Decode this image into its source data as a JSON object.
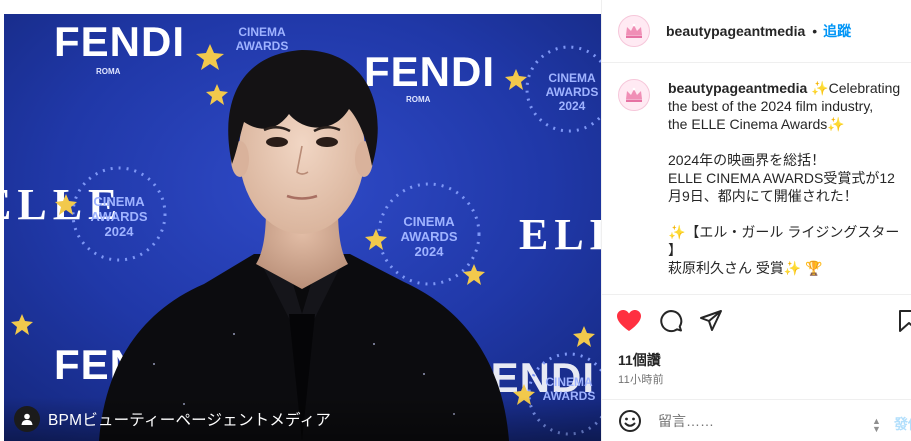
{
  "photo": {
    "backdrop_brand_logos": [
      "FENDI",
      "FENDI",
      "FENDI",
      "FENDI"
    ],
    "backdrop_event_text": [
      "CINEMA",
      "AWARDS",
      "2024"
    ],
    "backdrop_elle_mark": "ELLE",
    "backdrop_sponsor_sub": "ROMA",
    "credit_text": "BPMビューティーページェントメディア",
    "credit_icon": "user-tag-icon"
  },
  "post": {
    "username": "beautypageantmedia",
    "follow_separator": "•",
    "follow_label": "追蹤",
    "caption_username": "beautypageantmedia",
    "caption_lines": [
      "✨Celebrating",
      "the best of the 2024 film industry,",
      "the ELLE Cinema Awards✨",
      "",
      "2024年の映画界を総括！",
      "ELLE CINEMA AWARDS受賞式が12",
      "月9日、都内にて開催された！",
      "",
      "✨【エル・ガール ライジングスター",
      "】",
      "萩原利久さん 受賞✨ 🏆"
    ],
    "likes_text": "11個讚",
    "time_text": "11小時前",
    "comment_placeholder": "留言……",
    "post_button_label": "發佈",
    "sort_arrows": "▲\n▼",
    "icons": {
      "like": "heart-icon",
      "comment": "comment-icon",
      "share": "share-icon",
      "save": "bookmark-icon",
      "emoji": "emoji-icon"
    }
  },
  "colors": {
    "accent_blue": "#0095f6",
    "like_red": "#ff3040",
    "backdrop_blue": "#1f35a3",
    "muted_text": "#737373"
  }
}
